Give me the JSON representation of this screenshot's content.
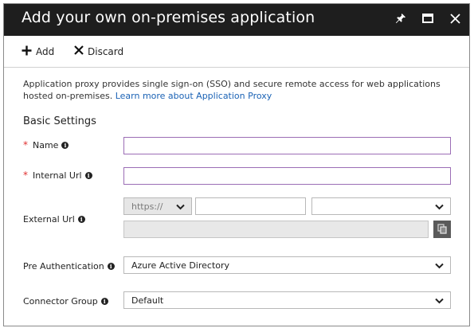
{
  "window": {
    "title": "Add your own on-premises application"
  },
  "titlebar_icons": [
    "pin-icon",
    "maximize-icon",
    "close-icon"
  ],
  "toolbar": {
    "add_label": "Add",
    "discard_label": "Discard"
  },
  "description": {
    "text": "Application proxy provides single sign-on (SSO) and secure remote access for web applications hosted on-premises.",
    "link": "Learn more about Application Proxy"
  },
  "section_title": "Basic Settings",
  "fields": {
    "name": {
      "label": "Name",
      "required_mark": "*",
      "value": ""
    },
    "internal_url": {
      "label": "Internal Url",
      "required_mark": "*",
      "value": ""
    },
    "external_url": {
      "label": "External Url",
      "protocol": "https://",
      "subdomain": "",
      "domain": ""
    },
    "pre_authentication": {
      "label": "Pre Authentication",
      "value": "Azure Active Directory"
    },
    "connector_group": {
      "label": "Connector Group",
      "value": "Default"
    }
  },
  "info_glyph": "i",
  "colors": {
    "titlebar_bg": "#1e1e1e",
    "required": "#e03030",
    "link": "#1a62b5",
    "focus_border": "#9b6db5"
  }
}
